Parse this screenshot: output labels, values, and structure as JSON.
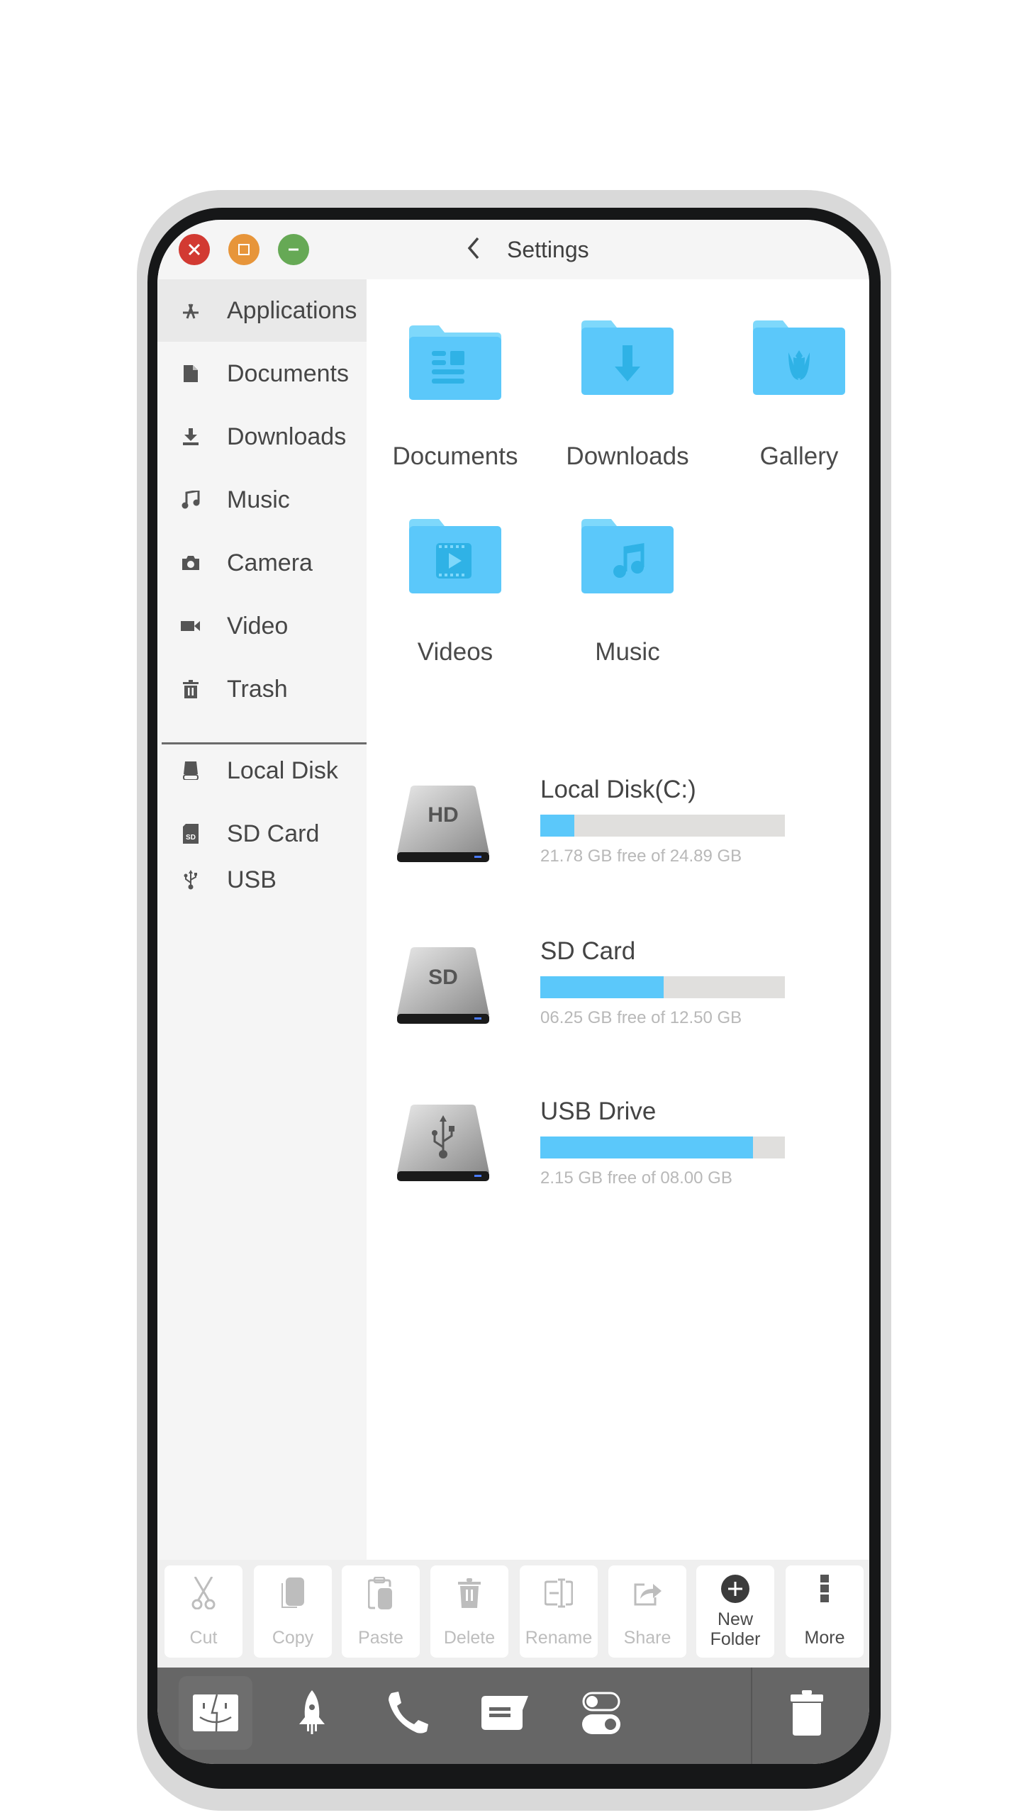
{
  "window": {
    "title": "Settings",
    "controls": {
      "close": "close",
      "maximize": "maximize",
      "minimize": "minimize"
    }
  },
  "sidebar": {
    "items": [
      {
        "label": "Applications",
        "icon": "app-store-icon",
        "active": true
      },
      {
        "label": "Documents",
        "icon": "document-icon"
      },
      {
        "label": "Downloads",
        "icon": "download-icon"
      },
      {
        "label": "Music",
        "icon": "music-note-icon"
      },
      {
        "label": "Camera",
        "icon": "camera-icon"
      },
      {
        "label": "Video",
        "icon": "video-camera-icon"
      },
      {
        "label": "Trash",
        "icon": "trash-icon"
      }
    ],
    "devices": [
      {
        "label": "Local Disk",
        "icon": "hard-drive-icon"
      },
      {
        "label": "SD Card",
        "icon": "sd-card-icon"
      },
      {
        "label": "USB",
        "icon": "usb-icon"
      }
    ]
  },
  "folders": [
    {
      "label": "Documents",
      "icon": "documents-folder-icon"
    },
    {
      "label": "Downloads",
      "icon": "downloads-folder-icon"
    },
    {
      "label": "Gallery",
      "icon": "gallery-folder-icon"
    },
    {
      "label": "Videos",
      "icon": "videos-folder-icon"
    },
    {
      "label": "Music",
      "icon": "music-folder-icon"
    }
  ],
  "drives": [
    {
      "name": "Local Disk(C:)",
      "badge": "HD",
      "free": "21.78 GB free of 24.89 GB",
      "used_fraction": 0.14,
      "icon": "hard-disk-icon"
    },
    {
      "name": "SD Card",
      "badge": "SD",
      "free": "06.25 GB free of 12.50 GB",
      "used_fraction": 0.505,
      "icon": "sd-drive-icon"
    },
    {
      "name": "USB Drive",
      "badge": "",
      "free": "2.15 GB free of 08.00 GB",
      "used_fraction": 0.87,
      "icon": "usb-drive-icon"
    }
  ],
  "toolbar": [
    {
      "label": "Cut",
      "icon": "scissors-icon",
      "enabled": false
    },
    {
      "label": "Copy",
      "icon": "copy-icon",
      "enabled": false
    },
    {
      "label": "Paste",
      "icon": "paste-icon",
      "enabled": false
    },
    {
      "label": "Delete",
      "icon": "trash-icon",
      "enabled": false
    },
    {
      "label": "Rename",
      "icon": "rename-icon",
      "enabled": false
    },
    {
      "label": "Share",
      "icon": "share-icon",
      "enabled": false
    },
    {
      "label": "New\nFolder",
      "label_line1": "New",
      "label_line2": "Folder",
      "icon": "plus-circle-icon",
      "enabled": true
    },
    {
      "label": "More",
      "icon": "more-vertical-icon",
      "enabled": true
    }
  ],
  "dock": [
    {
      "name": "finder",
      "icon": "finder-icon",
      "active": true
    },
    {
      "name": "launcher",
      "icon": "rocket-icon"
    },
    {
      "name": "phone",
      "icon": "phone-icon"
    },
    {
      "name": "messages",
      "icon": "message-icon"
    },
    {
      "name": "settings",
      "icon": "toggle-icon"
    },
    {
      "name": "trash",
      "icon": "trash-icon"
    }
  ],
  "colors": {
    "accent": "#5bc8fa",
    "folder": "#5bc8fa",
    "close": "#d23a32",
    "maximize": "#e7953a",
    "minimize": "#66a955",
    "dock": "#666666"
  }
}
